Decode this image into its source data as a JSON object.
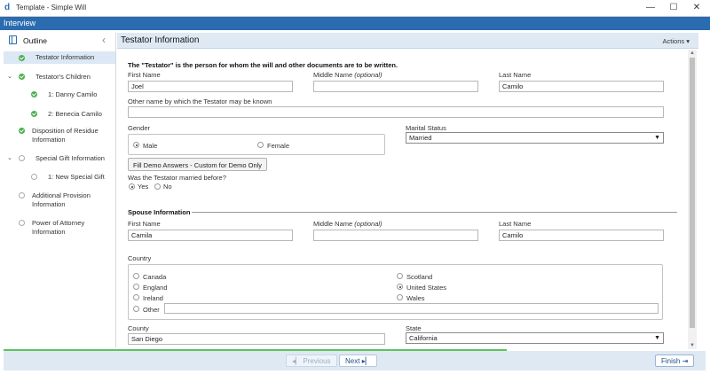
{
  "window": {
    "app_logo": "d",
    "title": "Template - Simple Will",
    "minimize": "—",
    "maximize": "☐",
    "close": "✕"
  },
  "interview_bar": {
    "label": "Interview"
  },
  "outline": {
    "title": "Outline",
    "collapse_glyph": "‹",
    "items": [
      {
        "label": "Testator Information",
        "status": "complete",
        "active": true
      },
      {
        "label": "Testator's Children",
        "status": "complete",
        "expanded": true
      },
      {
        "label": "1: Danny Camilo",
        "status": "complete"
      },
      {
        "label": "2: Benecia Camilo",
        "status": "complete"
      },
      {
        "label": "Disposition of Residue",
        "label2": "Information",
        "status": "complete"
      },
      {
        "label": "Special Gift Information",
        "status": "incomplete",
        "expanded": true
      },
      {
        "label": "1: New Special Gift",
        "status": "incomplete"
      },
      {
        "label": "Additional Provision",
        "label2": "Information",
        "status": "incomplete"
      },
      {
        "label": "Power of Attorney",
        "label2": "Information",
        "status": "incomplete"
      }
    ]
  },
  "main": {
    "title": "Testator Information",
    "actions_label": "Actions"
  },
  "form": {
    "intro": "The \"Testator\" is the person for whom the will and other documents are to be written.",
    "first_name_label": "First Name",
    "first_name_value": "Joel",
    "middle_name_label": "Middle Name",
    "middle_name_optional": "(optional)",
    "middle_name_value": "",
    "last_name_label": "Last Name",
    "last_name_value": "Camilo",
    "other_name_label": "Other name by which the Testator may be known",
    "other_name_value": "",
    "gender_label": "Gender",
    "gender_options": [
      "Male",
      "Female"
    ],
    "gender_selected": "Male",
    "marital_status_label": "Marital Status",
    "marital_status_value": "Married",
    "demo_button": "Fill Demo Answers - Custom for Demo Only",
    "married_before_label": "Was the Testator married before?",
    "married_before_options": [
      "Yes",
      "No"
    ],
    "married_before_selected": "Yes",
    "spouse_section_title": "Spouse Information",
    "spouse_first_name_label": "First Name",
    "spouse_first_name_value": "Camila",
    "spouse_middle_name_label": "Middle Name",
    "spouse_middle_name_optional": "(optional)",
    "spouse_middle_name_value": "",
    "spouse_last_name_label": "Last Name",
    "spouse_last_name_value": "Camilo",
    "country_label": "Country",
    "country_options": [
      "Canada",
      "England",
      "Ireland",
      "Other",
      "Scotland",
      "United States",
      "Wales"
    ],
    "country_selected": "United States",
    "country_other_value": "",
    "county_label": "County",
    "county_value": "San Diego",
    "state_label": "State",
    "state_value": "California"
  },
  "footer": {
    "previous_label": "Previous",
    "next_label": "Next",
    "finish_label": "Finish",
    "progress_fraction": 0.72
  },
  "colors": {
    "header_blue": "#2b6cb0",
    "panel_blue": "#dfe9f4",
    "complete_green": "#4caf50",
    "progress_green": "#5cc25c"
  }
}
